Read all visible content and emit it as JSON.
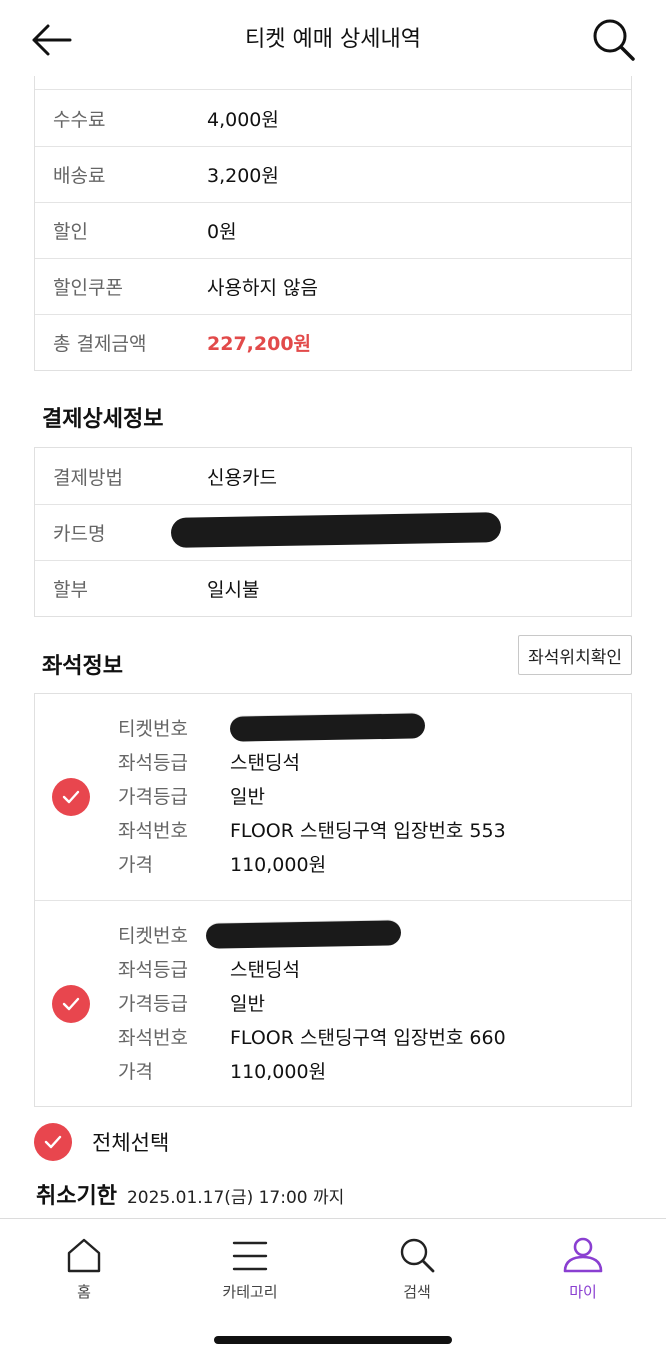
{
  "header": {
    "title": "티켓 예매 상세내역",
    "back_icon": "arrow-left-icon",
    "search_icon": "search-icon"
  },
  "price_summary": [
    {
      "label": "수수료",
      "value": "4,000원"
    },
    {
      "label": "배송료",
      "value": "3,200원"
    },
    {
      "label": "할인",
      "value": "0원"
    },
    {
      "label": "할인쿠폰",
      "value": "사용하지 않음"
    },
    {
      "label": "총 결제금액",
      "value": "227,200원"
    }
  ],
  "payment": {
    "title": "결제상세정보",
    "rows": [
      {
        "label": "결제방법",
        "value": "신용카드"
      },
      {
        "label": "카드명",
        "value": ""
      },
      {
        "label": "할부",
        "value": "일시불"
      }
    ]
  },
  "seats": {
    "title": "좌석정보",
    "check_location_label": "좌석위치확인",
    "labels": {
      "ticket_no": "티켓번호",
      "seat_grade": "좌석등급",
      "price_grade": "가격등급",
      "seat_no": "좌석번호",
      "price": "가격"
    },
    "tickets": [
      {
        "seat_grade": "스탠딩석",
        "price_grade": "일반",
        "seat_no": "FLOOR 스탠딩구역 입장번호 553",
        "price": "110,000원"
      },
      {
        "seat_grade": "스탠딩석",
        "price_grade": "일반",
        "seat_no": "FLOOR 스탠딩구역 입장번호 660",
        "price": "110,000원"
      }
    ]
  },
  "select_all": "전체선택",
  "cancel_deadline": {
    "label": "취소기한",
    "value": "2025.01.17(금) 17:00 까지"
  },
  "tabbar": {
    "items": [
      {
        "label": "홈",
        "icon": "home-icon"
      },
      {
        "label": "카테고리",
        "icon": "menu-icon"
      },
      {
        "label": "검색",
        "icon": "search-icon"
      },
      {
        "label": "마이",
        "icon": "user-icon"
      }
    ],
    "active_color": "#8a3fd1"
  },
  "colors": {
    "accent_red": "#e8464e",
    "total_red": "#e24a4a"
  }
}
